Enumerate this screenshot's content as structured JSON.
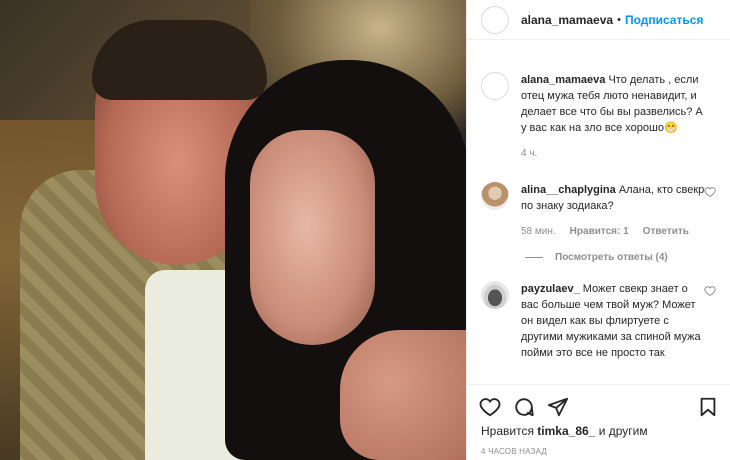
{
  "header": {
    "username": "alana_mamaeva",
    "separator": "•",
    "follow_label": "Подписаться"
  },
  "caption": {
    "username": "alana_mamaeva",
    "text": "Что делать , если отец мужа тебя люто ненавидит, и делает все что бы вы развелись? А у вас как на зло все хорошо",
    "emoji": "😁",
    "time": "4 ч."
  },
  "comments": [
    {
      "username": "alina__chaplygina",
      "text": "Алана, кто свекр по знаку зодиака?",
      "time": "58 мин.",
      "likes": "Нравится: 1",
      "reply_label": "Ответить",
      "view_replies": "Посмотреть ответы (4)"
    },
    {
      "username": "payzulaev_",
      "text": "Может свекр знает о вас больше чем твой муж? Может он видел как вы флиртуете с другими мужиками за спиной мужа пойми это все не просто так"
    }
  ],
  "likes": {
    "prefix": "Нравится",
    "user": "timka_86_",
    "suffix": "и другим"
  },
  "post_time": "4 ЧАСОВ НАЗАД",
  "icons": [
    "heart-icon",
    "comment-icon",
    "share-icon",
    "bookmark-icon"
  ]
}
